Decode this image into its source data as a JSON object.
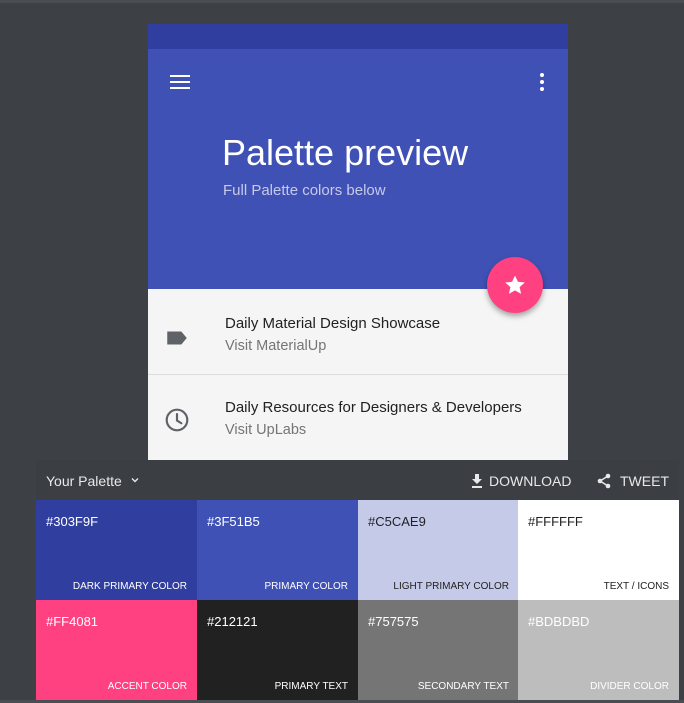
{
  "preview": {
    "title": "Palette preview",
    "subtitle": "Full Palette colors below",
    "menu_icon": "menu-icon",
    "more_icon": "more-vert-icon",
    "fab_icon": "star-icon",
    "list": [
      {
        "title": "Daily Material Design Showcase",
        "subtitle": "Visit MaterialUp",
        "icon": "label-icon"
      },
      {
        "title": "Daily Resources for Designers & Developers",
        "subtitle": "Visit UpLabs",
        "icon": "clock-icon"
      }
    ]
  },
  "palette": {
    "name": "Your Palette",
    "download_label": "DOWNLOAD",
    "tweet_label": "TWEET",
    "swatches": [
      {
        "hex": "#303F9F",
        "role": "Dark Primary Color",
        "color": "#303F9F",
        "text_color": "#FFFFFF"
      },
      {
        "hex": "#3F51B5",
        "role": "Primary Color",
        "color": "#3F51B5",
        "text_color": "#FFFFFF"
      },
      {
        "hex": "#C5CAE9",
        "role": "Light Primary Color",
        "color": "#C5CAE9",
        "text_color": "#212121"
      },
      {
        "hex": "#FFFFFF",
        "role": "Text / Icons",
        "color": "#FFFFFF",
        "text_color": "#212121"
      },
      {
        "hex": "#FF4081",
        "role": "Accent Color",
        "color": "#FF4081",
        "text_color": "#FFFFFF"
      },
      {
        "hex": "#212121",
        "role": "Primary Text",
        "color": "#212121",
        "text_color": "#FFFFFF"
      },
      {
        "hex": "#757575",
        "role": "Secondary Text",
        "color": "#757575",
        "text_color": "#FFFFFF"
      },
      {
        "hex": "#BDBDBD",
        "role": "Divider Color",
        "color": "#BDBDBD",
        "text_color": "#FFFFFF"
      }
    ]
  }
}
